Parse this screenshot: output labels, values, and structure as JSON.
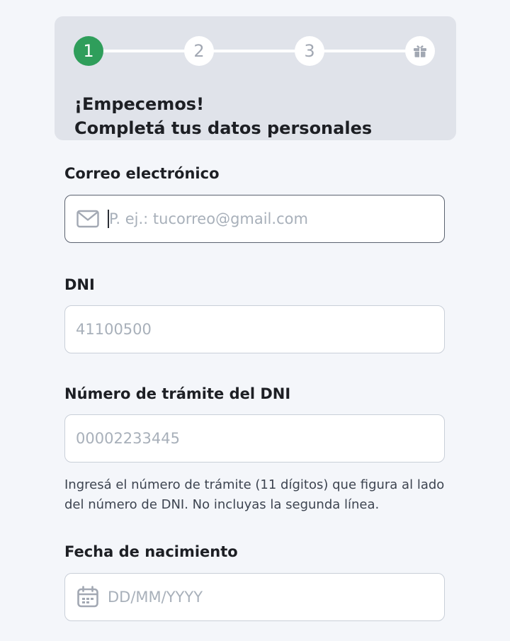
{
  "stepper": {
    "steps": [
      {
        "label": "1",
        "state": "active"
      },
      {
        "label": "2",
        "state": "upcoming"
      },
      {
        "label": "3",
        "state": "upcoming"
      },
      {
        "icon": "gift-icon",
        "state": "upcoming"
      }
    ],
    "active_color": "#2f9e5b"
  },
  "header": {
    "title_line1": "¡Empecemos!",
    "title_line2": "Completá tus datos personales"
  },
  "form": {
    "email": {
      "label": "Correo electrónico",
      "placeholder": "P. ej.: tucorreo@gmail.com",
      "icon": "envelope-icon"
    },
    "dni": {
      "label": "DNI",
      "placeholder": "41100500"
    },
    "tramite": {
      "label": "Número de trámite del DNI",
      "placeholder": "00002233445",
      "help": "Ingresá el número de trámite (11 dígitos) que figura al lado del número de DNI. No incluyas la segunda línea."
    },
    "birthdate": {
      "label": "Fecha de nacimiento",
      "placeholder": "DD/MM/YYYY",
      "icon": "calendar-icon"
    }
  }
}
